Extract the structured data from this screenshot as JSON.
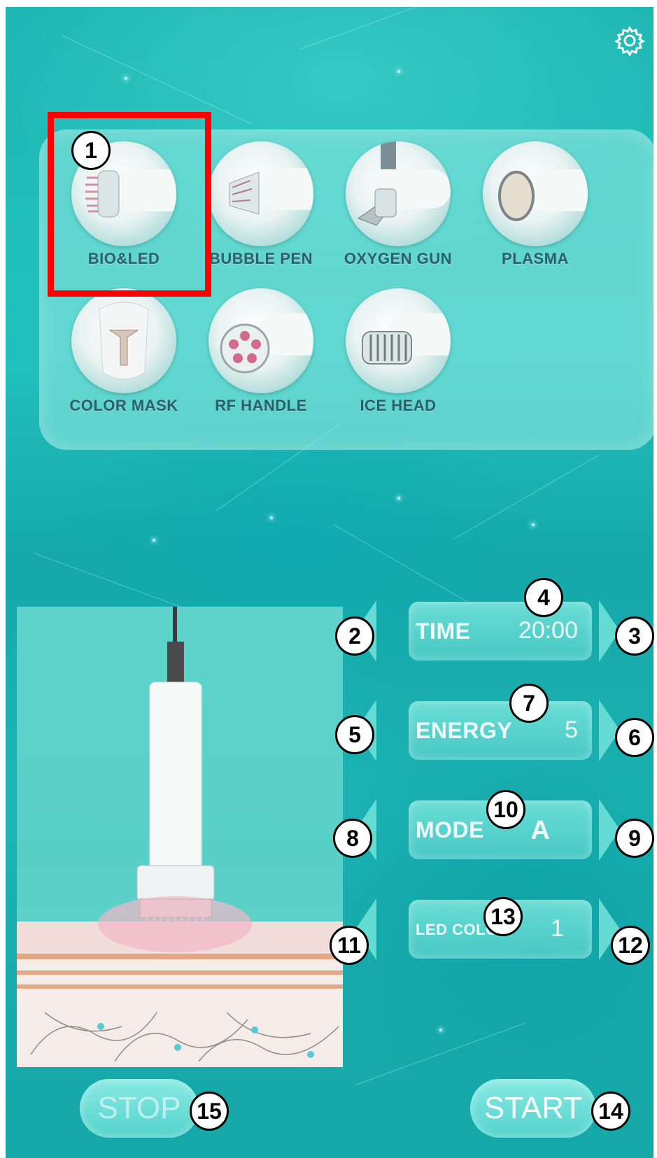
{
  "settings_icon": "gear-icon",
  "handles": [
    {
      "label": "BIO&LED",
      "icon": "bio-led-handle-icon"
    },
    {
      "label": "BUBBLE PEN",
      "icon": "bubble-pen-handle-icon"
    },
    {
      "label": "OXYGEN GUN",
      "icon": "oxygen-gun-handle-icon"
    },
    {
      "label": "PLASMA",
      "icon": "plasma-handle-icon"
    },
    {
      "label": "COLOR MASK",
      "icon": "color-mask-icon"
    },
    {
      "label": "RF HANDLE",
      "icon": "rf-handle-icon"
    },
    {
      "label": "ICE HEAD",
      "icon": "ice-head-icon"
    }
  ],
  "selected_handle": "BIO&LED",
  "controls": {
    "time": {
      "label": "TIME",
      "value": "20:00"
    },
    "energy": {
      "label": "ENERGY",
      "value": "5"
    },
    "mode": {
      "label": "MODE",
      "value": "A"
    },
    "led_color": {
      "label": "LED COLOR",
      "value": "1"
    }
  },
  "buttons": {
    "stop": "STOP",
    "start": "START"
  },
  "callouts": [
    "1",
    "2",
    "3",
    "4",
    "5",
    "6",
    "7",
    "8",
    "9",
    "10",
    "11",
    "12",
    "13",
    "14",
    "15"
  ],
  "colors": {
    "background": "#1fb7b3",
    "highlight": "#ff0000",
    "label_text": "#2d5f68"
  }
}
